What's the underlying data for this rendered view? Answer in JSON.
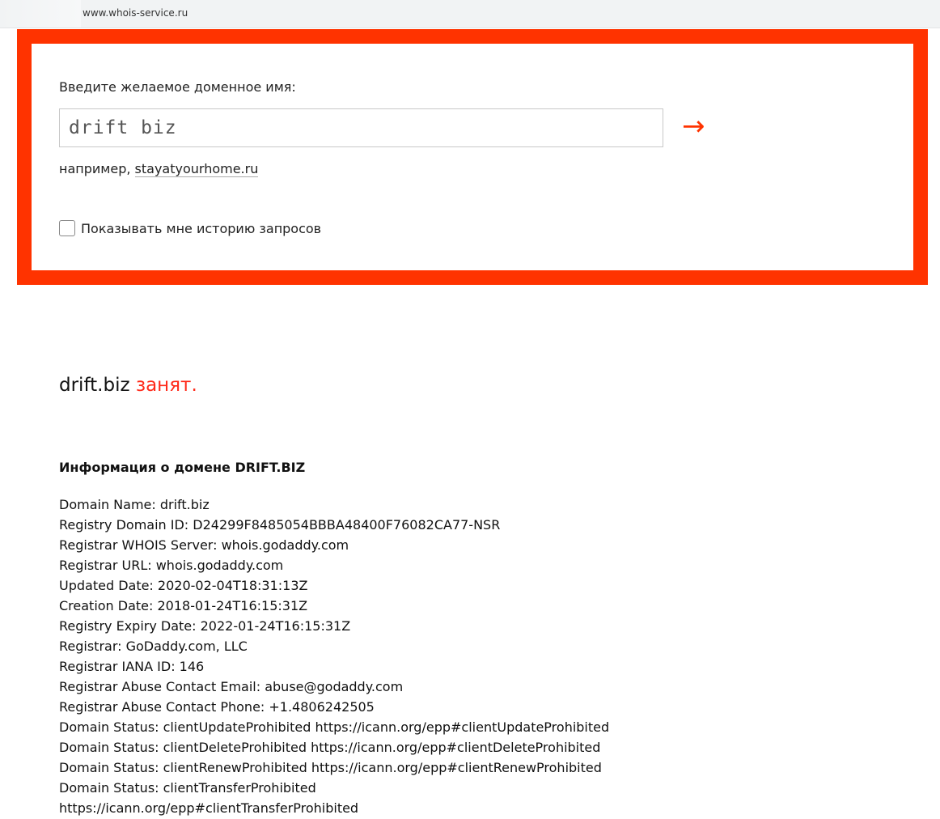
{
  "browser": {
    "url": "www.whois-service.ru"
  },
  "search": {
    "label": "Введите желаемое доменное имя:",
    "value": "drift biz",
    "submit_icon": "→",
    "example_prefix": "например, ",
    "example_link": "stayatyourhome.ru",
    "history_label": "Показывать мне историю запросов",
    "history_checked": false
  },
  "result": {
    "domain": "drift.biz",
    "status": "занят."
  },
  "whois": {
    "heading": "Информация о домене DRIFT.BIZ",
    "lines": [
      "Domain Name: drift.biz",
      "Registry Domain ID: D24299F8485054BBBA48400F76082CA77-NSR",
      "Registrar WHOIS Server: whois.godaddy.com",
      "Registrar URL: whois.godaddy.com",
      "Updated Date: 2020-02-04T18:31:13Z",
      "Creation Date: 2018-01-24T16:15:31Z",
      "Registry Expiry Date: 2022-01-24T16:15:31Z",
      "Registrar: GoDaddy.com, LLC",
      "Registrar IANA ID: 146",
      "Registrar Abuse Contact Email: abuse@godaddy.com",
      "Registrar Abuse Contact Phone: +1.4806242505",
      "Domain Status: clientUpdateProhibited https://icann.org/epp#clientUpdateProhibited",
      "Domain Status: clientDeleteProhibited https://icann.org/epp#clientDeleteProhibited",
      "Domain Status: clientRenewProhibited https://icann.org/epp#clientRenewProhibited",
      "Domain Status: clientTransferProhibited",
      "https://icann.org/epp#clientTransferProhibited"
    ]
  },
  "colors": {
    "accent": "#ff3300",
    "status_taken": "#ff2a1a"
  }
}
